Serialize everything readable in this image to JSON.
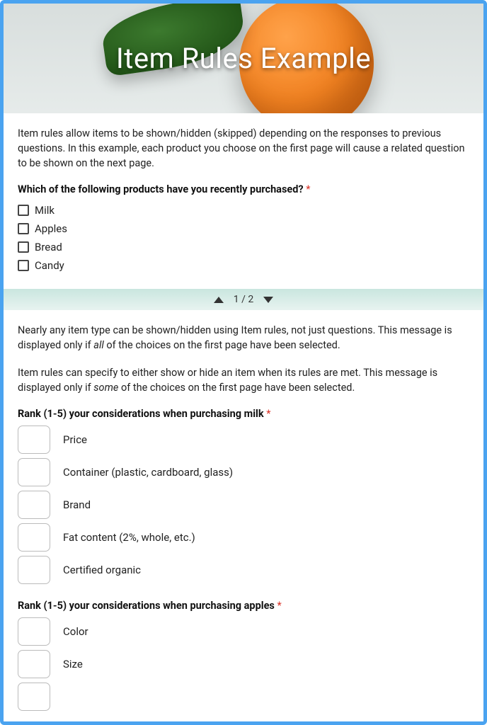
{
  "banner": {
    "title": "Item Rules Example"
  },
  "page1": {
    "intro": "Item rules allow items to be shown/hidden (skipped) depending on the responses to previous questions. In this example, each product you choose on the first page will cause a related question to be shown on the next page.",
    "question": "Which of the following products have you recently purchased?",
    "options": [
      "Milk",
      "Apples",
      "Bread",
      "Candy"
    ]
  },
  "pager": {
    "label": "1 / 2"
  },
  "page2": {
    "msg1_pre": "Nearly any item type can be shown/hidden using Item rules, not just questions. This message is displayed only if ",
    "msg1_em": "all",
    "msg1_post": " of the choices on the first page have been selected.",
    "msg2_pre": "Item rules can specify to either show or hide an item when its rules are met. This message is displayed only if ",
    "msg2_em": "some",
    "msg2_post": " of the choices on the first page have been selected.",
    "rank_milk": {
      "title": "Rank (1-5) your considerations when purchasing milk",
      "items": [
        "Price",
        "Container (plastic, cardboard, glass)",
        "Brand",
        "Fat content (2%, whole, etc.)",
        "Certified organic"
      ]
    },
    "rank_apples": {
      "title": "Rank (1-5) your considerations when purchasing apples",
      "items": [
        "Color",
        "Size"
      ]
    }
  },
  "required_marker": "*"
}
